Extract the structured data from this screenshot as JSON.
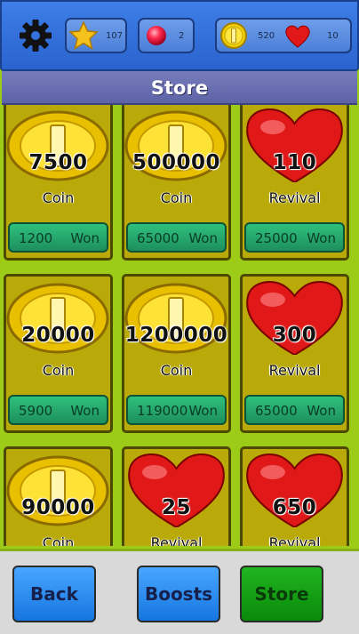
{
  "hud": {
    "stars": "107",
    "gems": "2",
    "coins": "520",
    "lives": "10",
    "colors": {
      "hud_blue": "#2f6fdc",
      "star": "#f5c21b",
      "gem": "#e0103a",
      "coin": "#f0d000",
      "heart": "#e01818"
    }
  },
  "title": "Store",
  "items": [
    {
      "amount": "7500",
      "kind": "Coin",
      "price": "1200",
      "currency": "Won",
      "icon": "coin-icon"
    },
    {
      "amount": "500000",
      "kind": "Coin",
      "price": "65000",
      "currency": "Won",
      "icon": "coin-icon"
    },
    {
      "amount": "110",
      "kind": "Revival",
      "price": "25000",
      "currency": "Won",
      "icon": "heart-icon"
    },
    {
      "amount": "20000",
      "kind": "Coin",
      "price": "5900",
      "currency": "Won",
      "icon": "coin-icon"
    },
    {
      "amount": "1200000",
      "kind": "Coin",
      "price": "119000",
      "currency": "Won",
      "icon": "coin-icon"
    },
    {
      "amount": "300",
      "kind": "Revival",
      "price": "65000",
      "currency": "Won",
      "icon": "heart-icon"
    },
    {
      "amount": "90000",
      "kind": "Coin",
      "price": "",
      "currency": "",
      "icon": "coin-icon"
    },
    {
      "amount": "25",
      "kind": "Revival",
      "price": "",
      "currency": "",
      "icon": "heart-icon"
    },
    {
      "amount": "650",
      "kind": "Revival",
      "price": "",
      "currency": "",
      "icon": "heart-icon"
    }
  ],
  "bottom": {
    "back": "Back",
    "boosts": "Boosts",
    "store": "Store"
  }
}
